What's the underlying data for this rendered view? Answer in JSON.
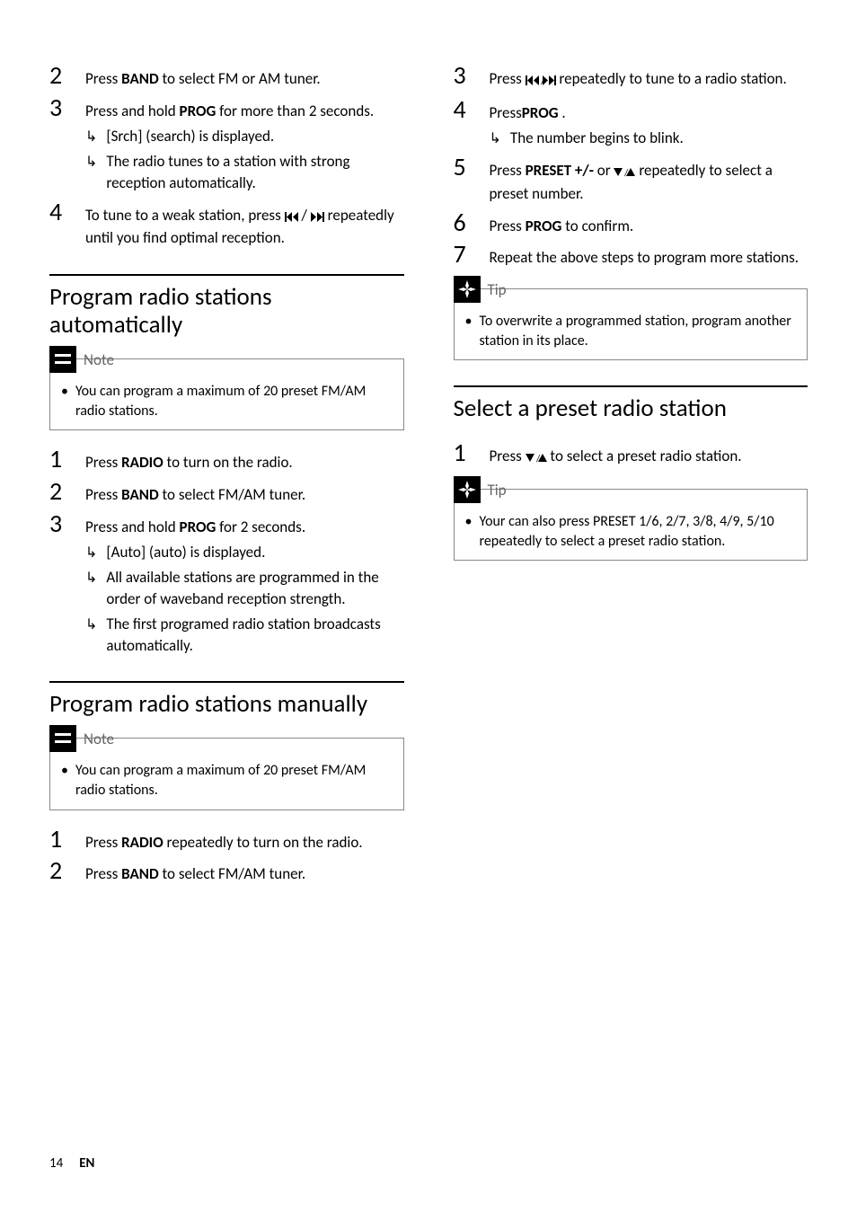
{
  "icons": {
    "prev": "⏮",
    "next": "⏭",
    "prevnext": "⏮/⏭",
    "down": "▼",
    "up": "▲",
    "downup": "▼/▲"
  },
  "labels": {
    "note": "Note",
    "tip": "Tip"
  },
  "col1": {
    "intro_steps": {
      "s2_a": "Press ",
      "s2_b": "BAND",
      "s2_c": " to select FM or AM tuner.",
      "s3_a": "Press and hold ",
      "s3_b": "PROG",
      "s3_c": " for more than 2 seconds.",
      "s3_sub1": "[Srch] (search) is displayed.",
      "s3_sub2": "The radio tunes to a station with strong reception automatically.",
      "s4_a": "To tune to a weak station, press ",
      "s4_c": " repeatedly until you find optimal reception."
    },
    "sec_auto": {
      "title": "Program radio stations automatically",
      "note": "You can program a maximum of 20 preset FM/AM radio stations.",
      "s1_a": "Press ",
      "s1_b": "RADIO",
      "s1_c": " to turn on the radio.",
      "s2_a": "Press ",
      "s2_b": "BAND",
      "s2_c": " to select FM/AM tuner.",
      "s3_a": "Press and hold ",
      "s3_b": "PROG",
      "s3_c": " for 2 seconds.",
      "s3_sub1": "[Auto] (auto) is displayed.",
      "s3_sub2": "All available stations are programmed in the order of waveband reception strength.",
      "s3_sub3": "The first programed radio station broadcasts automatically."
    },
    "sec_manual": {
      "title": "Program radio stations manually",
      "note": "You can program a maximum of 20 preset FM/AM radio stations.",
      "s1_a": "Press ",
      "s1_b": "RADIO",
      "s1_c": " repeatedly to turn on the radio.",
      "s2_a": "Press ",
      "s2_b": "BAND",
      "s2_c": " to select FM/AM tuner."
    }
  },
  "col2": {
    "cont_steps": {
      "s3_a": "Press ",
      "s3_c": " repeatedly to tune to a radio station.",
      "s4_a": "Press",
      "s4_b": "PROG",
      "s4_c": " .",
      "s4_sub1": "The number begins to blink.",
      "s5_a": "Press ",
      "s5_b": "PRESET +/-",
      "s5_c": " or ",
      "s5_e": " repeatedly to select a preset number.",
      "s6_a": "Press ",
      "s6_b": "PROG",
      "s6_c": " to confirm.",
      "s7": "Repeat the above steps to program more stations."
    },
    "tip1": "To overwrite a programmed station, program another station in its place.",
    "sec_select": {
      "title": "Select a preset radio station",
      "s1_a": "Press ",
      "s1_c": " to select a preset radio station."
    },
    "tip2": "Your can also press PRESET 1/6, 2/7, 3/8, 4/9, 5/10 repeatedly to select a preset radio station."
  },
  "footer": {
    "page": "14",
    "lang": "EN"
  }
}
